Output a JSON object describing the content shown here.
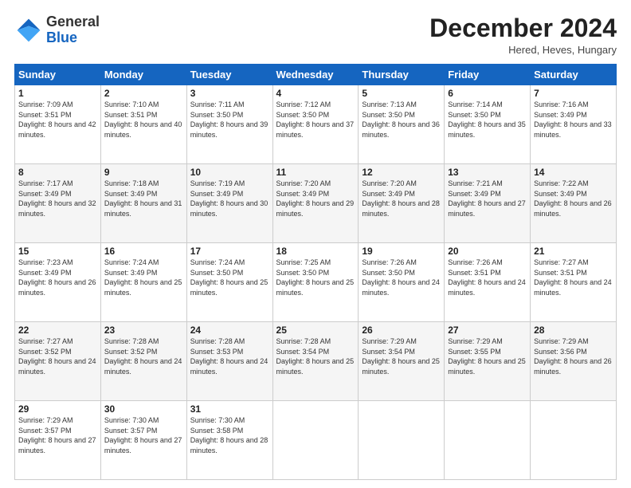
{
  "logo": {
    "general": "General",
    "blue": "Blue"
  },
  "title": "December 2024",
  "subtitle": "Hered, Heves, Hungary",
  "days_header": [
    "Sunday",
    "Monday",
    "Tuesday",
    "Wednesday",
    "Thursday",
    "Friday",
    "Saturday"
  ],
  "weeks": [
    [
      {
        "day": "1",
        "sunrise": "Sunrise: 7:09 AM",
        "sunset": "Sunset: 3:51 PM",
        "daylight": "Daylight: 8 hours and 42 minutes."
      },
      {
        "day": "2",
        "sunrise": "Sunrise: 7:10 AM",
        "sunset": "Sunset: 3:51 PM",
        "daylight": "Daylight: 8 hours and 40 minutes."
      },
      {
        "day": "3",
        "sunrise": "Sunrise: 7:11 AM",
        "sunset": "Sunset: 3:50 PM",
        "daylight": "Daylight: 8 hours and 39 minutes."
      },
      {
        "day": "4",
        "sunrise": "Sunrise: 7:12 AM",
        "sunset": "Sunset: 3:50 PM",
        "daylight": "Daylight: 8 hours and 37 minutes."
      },
      {
        "day": "5",
        "sunrise": "Sunrise: 7:13 AM",
        "sunset": "Sunset: 3:50 PM",
        "daylight": "Daylight: 8 hours and 36 minutes."
      },
      {
        "day": "6",
        "sunrise": "Sunrise: 7:14 AM",
        "sunset": "Sunset: 3:50 PM",
        "daylight": "Daylight: 8 hours and 35 minutes."
      },
      {
        "day": "7",
        "sunrise": "Sunrise: 7:16 AM",
        "sunset": "Sunset: 3:49 PM",
        "daylight": "Daylight: 8 hours and 33 minutes."
      }
    ],
    [
      {
        "day": "8",
        "sunrise": "Sunrise: 7:17 AM",
        "sunset": "Sunset: 3:49 PM",
        "daylight": "Daylight: 8 hours and 32 minutes."
      },
      {
        "day": "9",
        "sunrise": "Sunrise: 7:18 AM",
        "sunset": "Sunset: 3:49 PM",
        "daylight": "Daylight: 8 hours and 31 minutes."
      },
      {
        "day": "10",
        "sunrise": "Sunrise: 7:19 AM",
        "sunset": "Sunset: 3:49 PM",
        "daylight": "Daylight: 8 hours and 30 minutes."
      },
      {
        "day": "11",
        "sunrise": "Sunrise: 7:20 AM",
        "sunset": "Sunset: 3:49 PM",
        "daylight": "Daylight: 8 hours and 29 minutes."
      },
      {
        "day": "12",
        "sunrise": "Sunrise: 7:20 AM",
        "sunset": "Sunset: 3:49 PM",
        "daylight": "Daylight: 8 hours and 28 minutes."
      },
      {
        "day": "13",
        "sunrise": "Sunrise: 7:21 AM",
        "sunset": "Sunset: 3:49 PM",
        "daylight": "Daylight: 8 hours and 27 minutes."
      },
      {
        "day": "14",
        "sunrise": "Sunrise: 7:22 AM",
        "sunset": "Sunset: 3:49 PM",
        "daylight": "Daylight: 8 hours and 26 minutes."
      }
    ],
    [
      {
        "day": "15",
        "sunrise": "Sunrise: 7:23 AM",
        "sunset": "Sunset: 3:49 PM",
        "daylight": "Daylight: 8 hours and 26 minutes."
      },
      {
        "day": "16",
        "sunrise": "Sunrise: 7:24 AM",
        "sunset": "Sunset: 3:49 PM",
        "daylight": "Daylight: 8 hours and 25 minutes."
      },
      {
        "day": "17",
        "sunrise": "Sunrise: 7:24 AM",
        "sunset": "Sunset: 3:50 PM",
        "daylight": "Daylight: 8 hours and 25 minutes."
      },
      {
        "day": "18",
        "sunrise": "Sunrise: 7:25 AM",
        "sunset": "Sunset: 3:50 PM",
        "daylight": "Daylight: 8 hours and 25 minutes."
      },
      {
        "day": "19",
        "sunrise": "Sunrise: 7:26 AM",
        "sunset": "Sunset: 3:50 PM",
        "daylight": "Daylight: 8 hours and 24 minutes."
      },
      {
        "day": "20",
        "sunrise": "Sunrise: 7:26 AM",
        "sunset": "Sunset: 3:51 PM",
        "daylight": "Daylight: 8 hours and 24 minutes."
      },
      {
        "day": "21",
        "sunrise": "Sunrise: 7:27 AM",
        "sunset": "Sunset: 3:51 PM",
        "daylight": "Daylight: 8 hours and 24 minutes."
      }
    ],
    [
      {
        "day": "22",
        "sunrise": "Sunrise: 7:27 AM",
        "sunset": "Sunset: 3:52 PM",
        "daylight": "Daylight: 8 hours and 24 minutes."
      },
      {
        "day": "23",
        "sunrise": "Sunrise: 7:28 AM",
        "sunset": "Sunset: 3:52 PM",
        "daylight": "Daylight: 8 hours and 24 minutes."
      },
      {
        "day": "24",
        "sunrise": "Sunrise: 7:28 AM",
        "sunset": "Sunset: 3:53 PM",
        "daylight": "Daylight: 8 hours and 24 minutes."
      },
      {
        "day": "25",
        "sunrise": "Sunrise: 7:28 AM",
        "sunset": "Sunset: 3:54 PM",
        "daylight": "Daylight: 8 hours and 25 minutes."
      },
      {
        "day": "26",
        "sunrise": "Sunrise: 7:29 AM",
        "sunset": "Sunset: 3:54 PM",
        "daylight": "Daylight: 8 hours and 25 minutes."
      },
      {
        "day": "27",
        "sunrise": "Sunrise: 7:29 AM",
        "sunset": "Sunset: 3:55 PM",
        "daylight": "Daylight: 8 hours and 25 minutes."
      },
      {
        "day": "28",
        "sunrise": "Sunrise: 7:29 AM",
        "sunset": "Sunset: 3:56 PM",
        "daylight": "Daylight: 8 hours and 26 minutes."
      }
    ],
    [
      {
        "day": "29",
        "sunrise": "Sunrise: 7:29 AM",
        "sunset": "Sunset: 3:57 PM",
        "daylight": "Daylight: 8 hours and 27 minutes."
      },
      {
        "day": "30",
        "sunrise": "Sunrise: 7:30 AM",
        "sunset": "Sunset: 3:57 PM",
        "daylight": "Daylight: 8 hours and 27 minutes."
      },
      {
        "day": "31",
        "sunrise": "Sunrise: 7:30 AM",
        "sunset": "Sunset: 3:58 PM",
        "daylight": "Daylight: 8 hours and 28 minutes."
      },
      null,
      null,
      null,
      null
    ]
  ]
}
